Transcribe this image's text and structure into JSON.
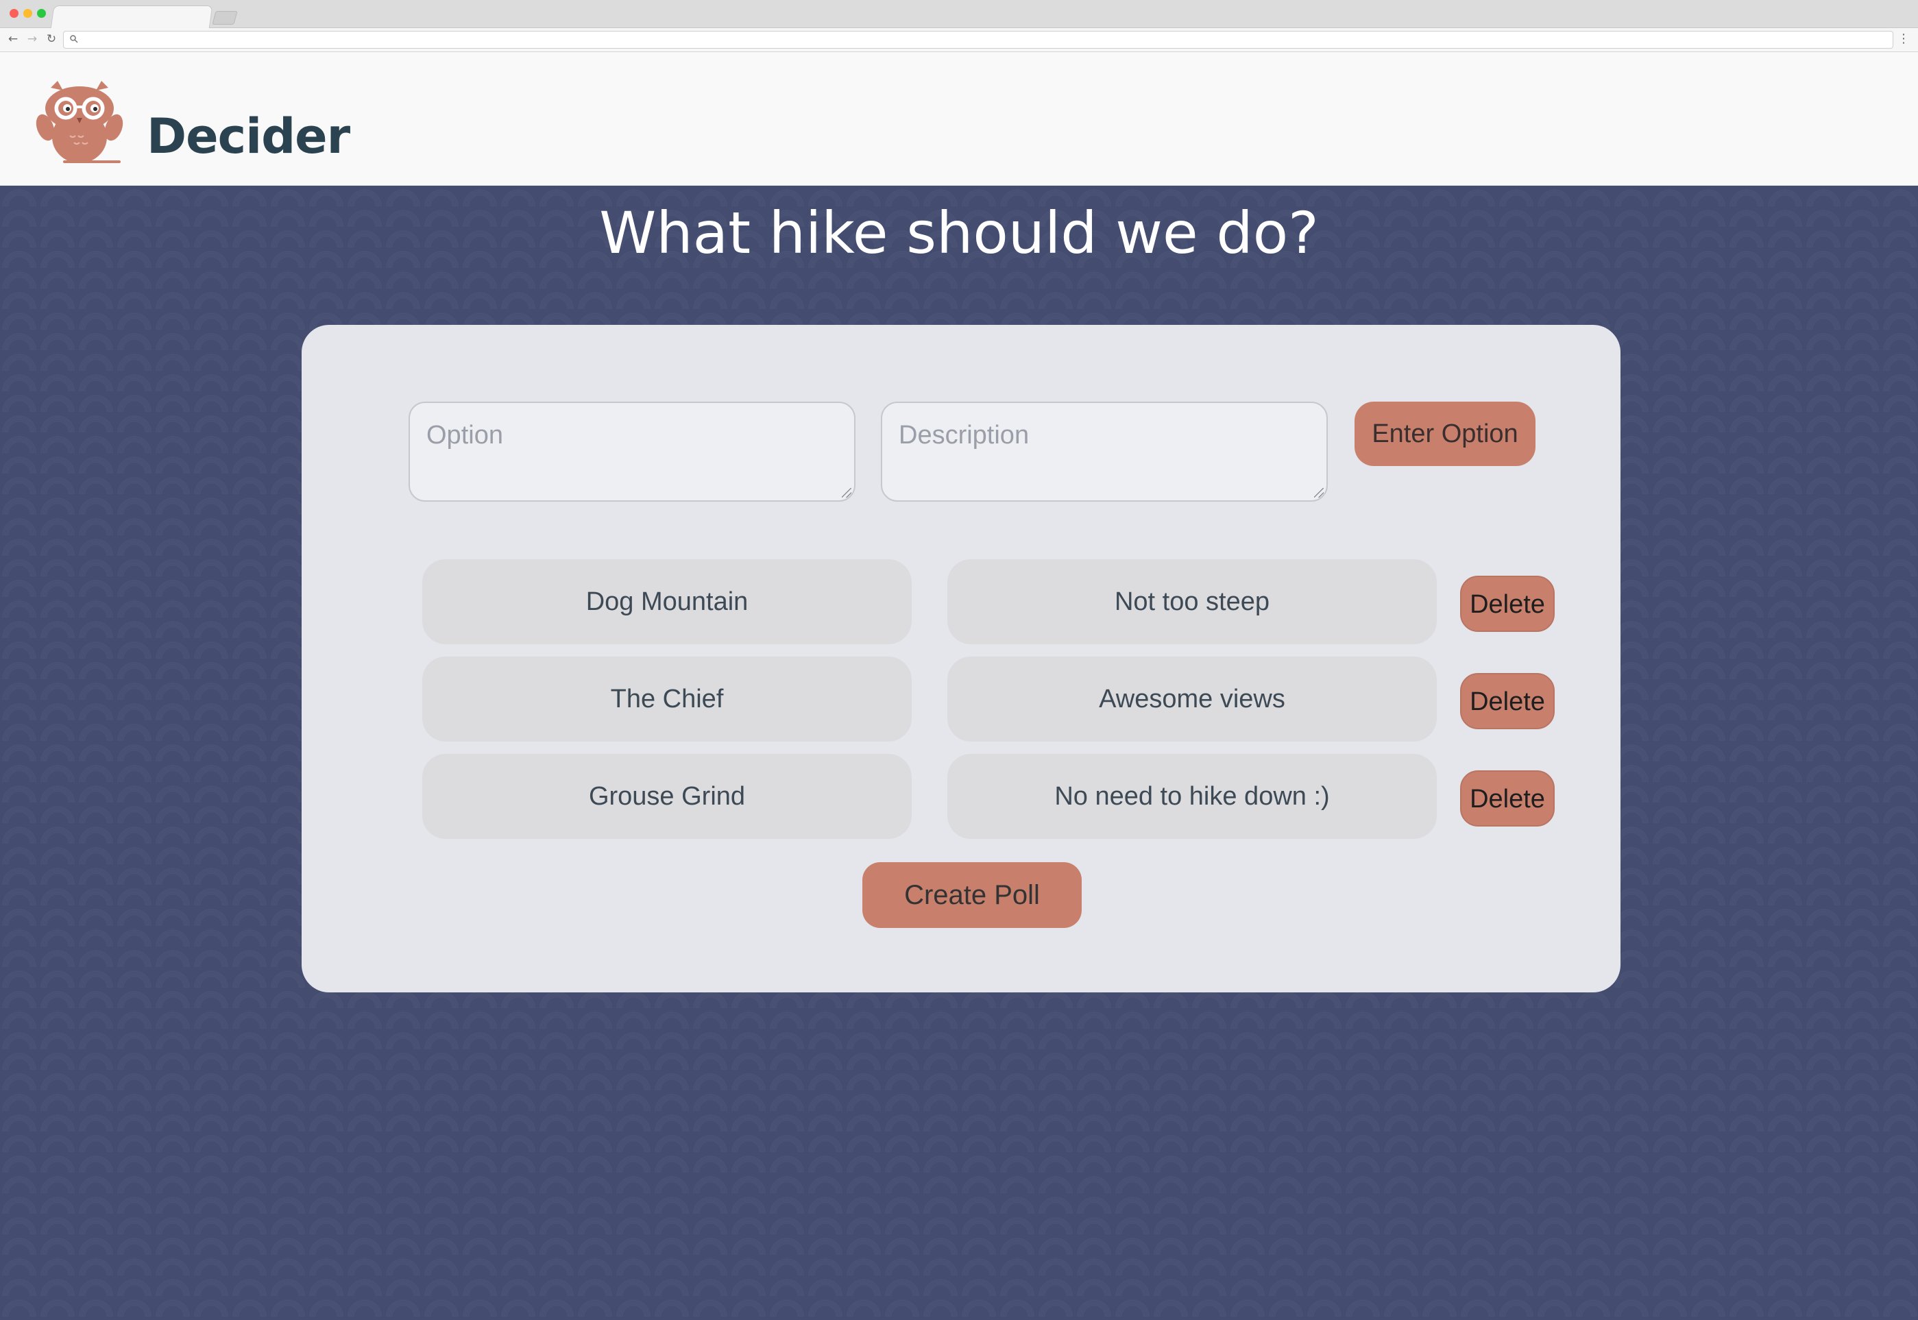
{
  "app": {
    "brand": "Decider",
    "logo_icon": "owl-with-glasses-icon"
  },
  "colors": {
    "accent": "#c8806d",
    "brand_text": "#2b4350",
    "background": "#444d70",
    "card": "#e4e6ec"
  },
  "page": {
    "title": "What hike should we do?"
  },
  "form": {
    "option_placeholder": "Option",
    "description_placeholder": "Description",
    "enter_button": "Enter Option"
  },
  "options": [
    {
      "name": "Dog Mountain",
      "description": "Not too steep",
      "delete_label": "Delete"
    },
    {
      "name": "The Chief",
      "description": "Awesome views",
      "delete_label": "Delete"
    },
    {
      "name": "Grouse Grind",
      "description": "No need to hike down :)",
      "delete_label": "Delete"
    }
  ],
  "actions": {
    "create_poll": "Create Poll"
  }
}
